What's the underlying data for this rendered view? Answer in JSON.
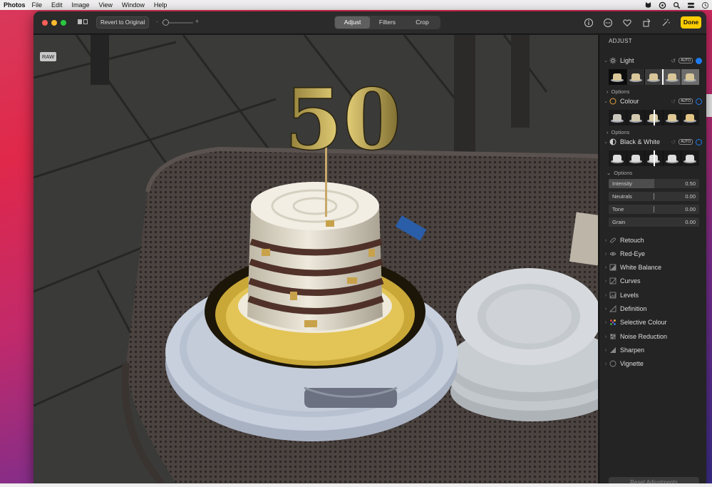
{
  "menubar": {
    "app": "Photos",
    "items": [
      "File",
      "Edit",
      "Image",
      "View",
      "Window",
      "Help"
    ]
  },
  "toolbar": {
    "revert_label": "Revert to Original",
    "zoom_minus": "-",
    "zoom_plus": "+",
    "tabs": [
      "Adjust",
      "Filters",
      "Crop"
    ],
    "active_tab": "Adjust",
    "done_label": "Done"
  },
  "photo": {
    "badge": "RAW",
    "topper_text": "50"
  },
  "sidebar": {
    "title": "ADJUST",
    "sections": [
      {
        "label": "Light",
        "auto": "AUTO",
        "enabled": true,
        "options_label": "Options"
      },
      {
        "label": "Colour",
        "auto": "AUTO",
        "enabled": false,
        "options_label": "Options"
      },
      {
        "label": "Black & White",
        "auto": "AUTO",
        "enabled": false,
        "options_label": "Options"
      }
    ],
    "bw_sliders": [
      {
        "label": "Intensity",
        "value": "0.50",
        "fraction": 0.5
      },
      {
        "label": "Neutrals",
        "value": "0.00",
        "fraction": 0.5
      },
      {
        "label": "Tone",
        "value": "0.00",
        "fraction": 0.5
      },
      {
        "label": "Grain",
        "value": "0.00",
        "fraction": 0.0
      }
    ],
    "tools": [
      "Retouch",
      "Red-Eye",
      "White Balance",
      "Curves",
      "Levels",
      "Definition",
      "Selective Colour",
      "Noise Reduction",
      "Sharpen",
      "Vignette"
    ],
    "reset_label": "Reset Adjustments"
  },
  "colors": {
    "accent": "#1e7cf2",
    "done": "#ffcc00"
  }
}
